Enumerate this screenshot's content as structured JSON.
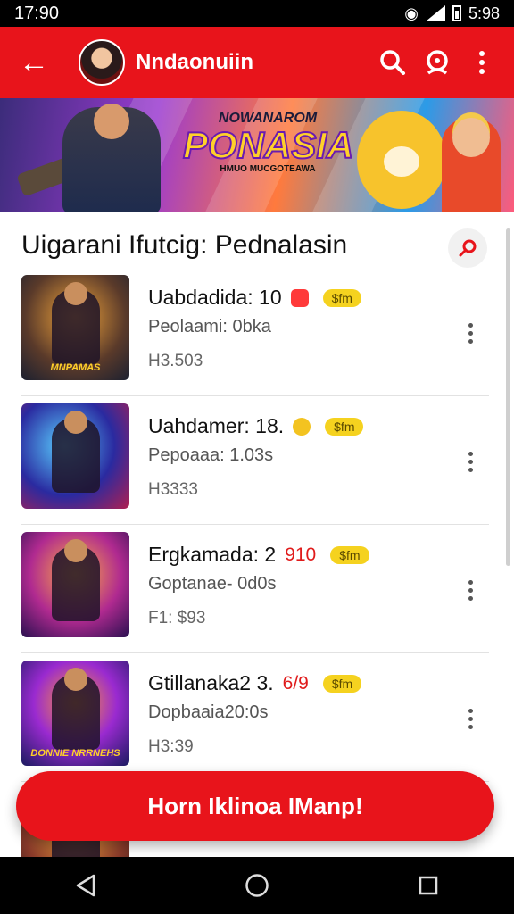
{
  "status": {
    "time": "17:90",
    "battery": "5:98"
  },
  "appbar": {
    "title": "Nndaonuiin"
  },
  "banner": {
    "logo_sub": "NOWANAROM",
    "logo_main": "PONASIA",
    "logo_tag": "HMUO MUCGOTEAWA"
  },
  "section": {
    "title": "Uigarani Ifutcig: Pednalasin"
  },
  "games": [
    {
      "title": "Uabdadida: 10",
      "score": "",
      "badge": "$fm",
      "subtitle": "Peolaami: 0bka",
      "price": "H3.503",
      "caption": "MNPAMAS",
      "emoji": "red"
    },
    {
      "title": "Uahdamer: 18.",
      "score": "",
      "badge": "$fm",
      "subtitle": "Pepoaaa: 1.03s",
      "price": "H3333",
      "caption": "",
      "emoji": "yellow"
    },
    {
      "title": "Ergkamada: 2",
      "score": "910",
      "badge": "$fm",
      "subtitle": "Goptanae- 0d0s",
      "price": "F1: $93",
      "caption": "",
      "emoji": ""
    },
    {
      "title": "Gtillanaka2 3.",
      "score": "6/9",
      "badge": "$fm",
      "subtitle": "Dopbaaia20:0s",
      "price": "H3:39",
      "caption": "DONNIE NRRNEHS",
      "emoji": ""
    }
  ],
  "cta": {
    "label": "Horn Iklinoa IManp!"
  },
  "colors": {
    "accent": "#e8141b",
    "badge": "#f5d21f"
  }
}
